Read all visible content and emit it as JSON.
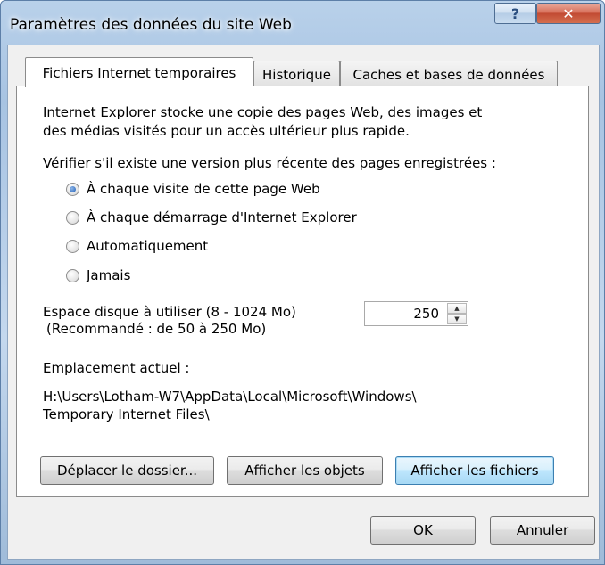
{
  "window": {
    "title": "Paramètres des données du site Web",
    "help_glyph": "?",
    "close_glyph": "✕"
  },
  "tabs": [
    {
      "label": "Fichiers Internet temporaires",
      "active": true
    },
    {
      "label": "Historique",
      "active": false
    },
    {
      "label": "Caches et bases de données",
      "active": false
    }
  ],
  "panel": {
    "intro_line1": "Internet Explorer stocke une copie des pages Web, des images et",
    "intro_line2": "des médias visités pour un accès ultérieur plus rapide.",
    "check_label": "Vérifier s'il existe une version plus récente des pages enregistrées :",
    "radios": [
      {
        "label": "À chaque visite de cette page Web",
        "checked": true
      },
      {
        "label": "À chaque démarrage d'Internet Explorer",
        "checked": false
      },
      {
        "label": "Automatiquement",
        "checked": false
      },
      {
        "label": "Jamais",
        "checked": false
      }
    ],
    "disk_label_line1": "Espace disque à utiliser (8 - 1024 Mo)",
    "disk_label_line2": "(Recommandé : de 50 à 250 Mo)",
    "disk_value": "250",
    "location_label": "Emplacement actuel :",
    "location_line1": "H:\\Users\\Lotham-W7\\AppData\\Local\\Microsoft\\Windows\\",
    "location_line2": "Temporary Internet Files\\",
    "buttons": {
      "move_folder": "Déplacer le dossier...",
      "view_objects": "Afficher les objets",
      "view_files": "Afficher les fichiers"
    }
  },
  "footer": {
    "ok": "OK",
    "cancel": "Annuler"
  }
}
